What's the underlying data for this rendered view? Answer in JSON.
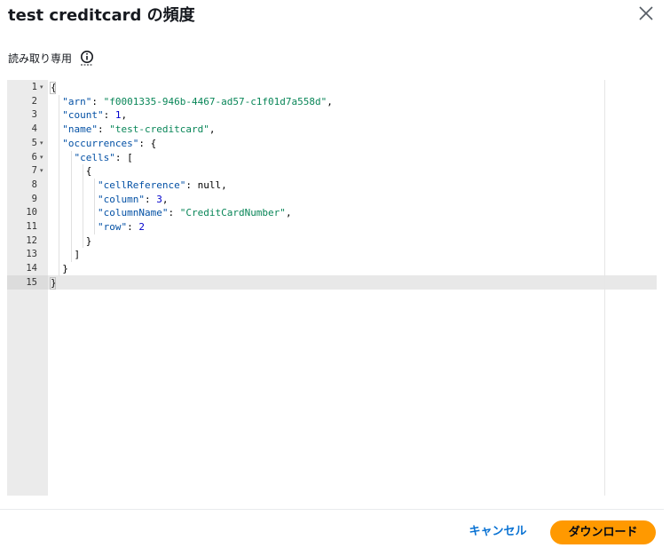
{
  "dialog": {
    "title": "test creditcard の頻度",
    "close_icon": "close-icon"
  },
  "readonly": {
    "label": "読み取り専用",
    "info_icon": "info-icon"
  },
  "editor": {
    "line_numbers": [
      "1",
      "2",
      "3",
      "4",
      "5",
      "6",
      "7",
      "8",
      "9",
      "10",
      "11",
      "12",
      "13",
      "14",
      "15"
    ],
    "active_line": 15,
    "foldable_lines": [
      1,
      5,
      6,
      7
    ],
    "lines": [
      [
        {
          "t": "p",
          "v": "{"
        }
      ],
      [
        {
          "t": "p",
          "v": "  "
        },
        {
          "t": "k",
          "v": "\"arn\""
        },
        {
          "t": "p",
          "v": ": "
        },
        {
          "t": "s",
          "v": "\"f0001335-946b-4467-ad57-c1f01d7a558d\""
        },
        {
          "t": "p",
          "v": ","
        }
      ],
      [
        {
          "t": "p",
          "v": "  "
        },
        {
          "t": "k",
          "v": "\"count\""
        },
        {
          "t": "p",
          "v": ": "
        },
        {
          "t": "n",
          "v": "1"
        },
        {
          "t": "p",
          "v": ","
        }
      ],
      [
        {
          "t": "p",
          "v": "  "
        },
        {
          "t": "k",
          "v": "\"name\""
        },
        {
          "t": "p",
          "v": ": "
        },
        {
          "t": "s",
          "v": "\"test-creditcard\""
        },
        {
          "t": "p",
          "v": ","
        }
      ],
      [
        {
          "t": "p",
          "v": "  "
        },
        {
          "t": "k",
          "v": "\"occurrences\""
        },
        {
          "t": "p",
          "v": ": {"
        }
      ],
      [
        {
          "t": "p",
          "v": "    "
        },
        {
          "t": "k",
          "v": "\"cells\""
        },
        {
          "t": "p",
          "v": ": ["
        }
      ],
      [
        {
          "t": "p",
          "v": "      {"
        }
      ],
      [
        {
          "t": "p",
          "v": "        "
        },
        {
          "t": "k",
          "v": "\"cellReference\""
        },
        {
          "t": "p",
          "v": ": "
        },
        {
          "t": "w",
          "v": "null"
        },
        {
          "t": "p",
          "v": ","
        }
      ],
      [
        {
          "t": "p",
          "v": "        "
        },
        {
          "t": "k",
          "v": "\"column\""
        },
        {
          "t": "p",
          "v": ": "
        },
        {
          "t": "n",
          "v": "3"
        },
        {
          "t": "p",
          "v": ","
        }
      ],
      [
        {
          "t": "p",
          "v": "        "
        },
        {
          "t": "k",
          "v": "\"columnName\""
        },
        {
          "t": "p",
          "v": ": "
        },
        {
          "t": "s",
          "v": "\"CreditCardNumber\""
        },
        {
          "t": "p",
          "v": ","
        }
      ],
      [
        {
          "t": "p",
          "v": "        "
        },
        {
          "t": "k",
          "v": "\"row\""
        },
        {
          "t": "p",
          "v": ": "
        },
        {
          "t": "n",
          "v": "2"
        }
      ],
      [
        {
          "t": "p",
          "v": "      }"
        }
      ],
      [
        {
          "t": "p",
          "v": "    ]"
        }
      ],
      [
        {
          "t": "p",
          "v": "  }"
        }
      ],
      [
        {
          "t": "p",
          "v": "}"
        }
      ]
    ]
  },
  "footer": {
    "cancel_label": "キャンセル",
    "download_label": "ダウンロード"
  },
  "colors": {
    "accent": "#ff9900",
    "link": "#0972d3",
    "json_key": "#0451a5",
    "json_string": "#098658",
    "json_number": "#0000cd"
  }
}
